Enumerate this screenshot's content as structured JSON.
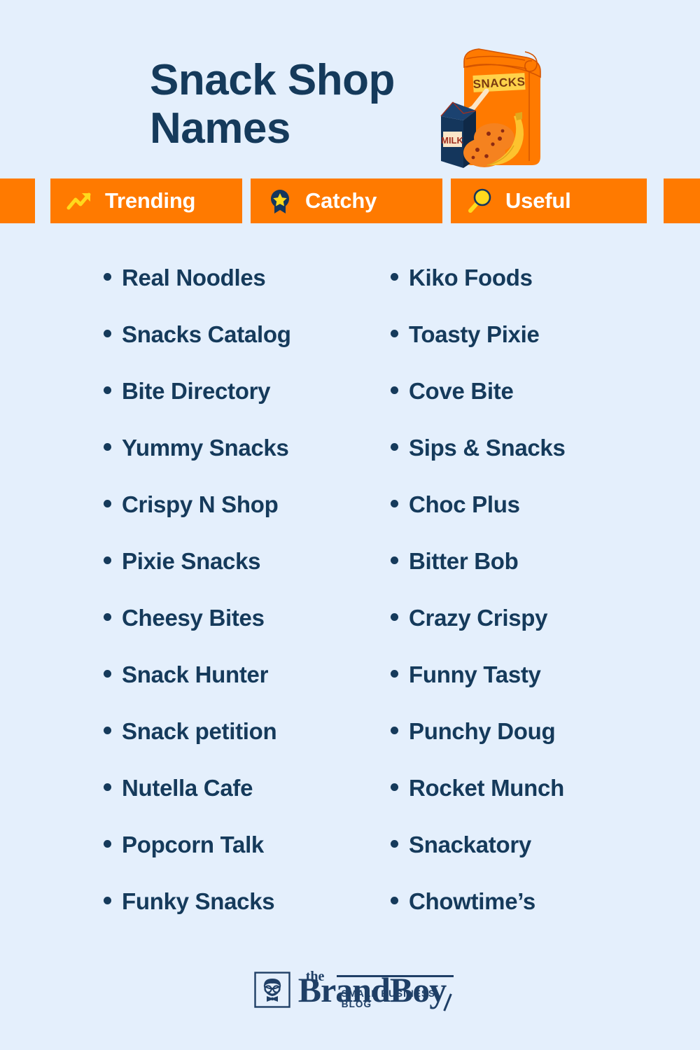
{
  "page": {
    "background_color": "#e4effc",
    "accent_color": "#ff7a00",
    "text_color": "#153a5b",
    "highlight_color": "#ffd91c"
  },
  "header": {
    "title_line1": "Snack Shop",
    "title_line2": "Names",
    "illustration": {
      "name": "snack-bag-illustration",
      "bag_label": "SNACKS",
      "carton_label": "MILK"
    }
  },
  "badges": [
    {
      "label": "Trending",
      "icon": "trending-up-icon"
    },
    {
      "label": "Catchy",
      "icon": "award-medal-icon"
    },
    {
      "label": "Useful",
      "icon": "magnifier-icon"
    }
  ],
  "names": {
    "left_column": [
      "Real Noodles",
      "Snacks Catalog",
      "Bite Directory",
      "Yummy Snacks",
      "Crispy N Shop",
      "Pixie Snacks",
      "Cheesy Bites",
      "Snack Hunter",
      "Snack petition",
      "Nutella Cafe",
      "Popcorn Talk",
      "Funky Snacks"
    ],
    "right_column": [
      "Kiko Foods",
      "Toasty Pixie",
      "Cove Bite",
      "Sips & Snacks",
      "Choc Plus",
      "Bitter Bob",
      "Crazy Crispy",
      "Funny Tasty",
      "Punchy Doug",
      "Rocket Munch",
      "Snackatory",
      "Chowtime’s"
    ]
  },
  "footer": {
    "logo_the": "the",
    "logo_name": "BrandBoy",
    "logo_tagline": "SMALL BUSINESS BLOG"
  }
}
